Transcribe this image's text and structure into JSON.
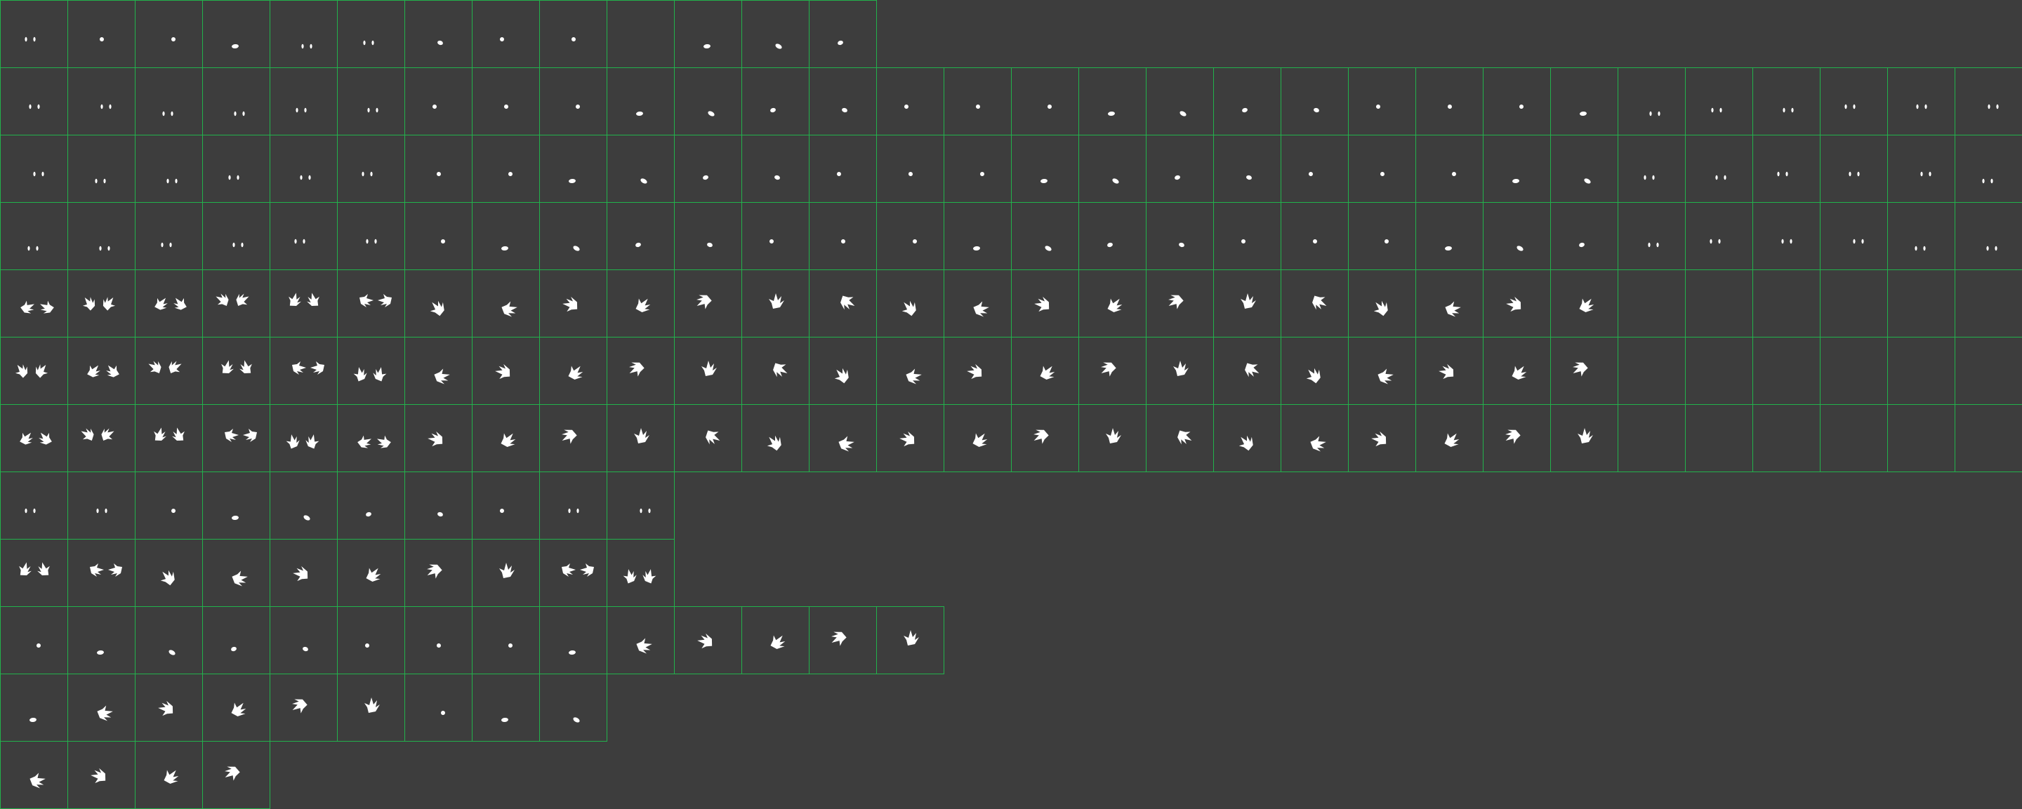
{
  "sprite_sheet": {
    "background_color": "#3d3d3d",
    "grid_color": "#22b24c",
    "sprite_color": "#ffffff",
    "rows": [
      {
        "name": "eyes-row-1",
        "frames": [
          "eyes",
          "blob",
          "blob",
          "blob",
          "eyes",
          "eyes",
          "blob",
          "blob",
          "blob",
          "empty",
          "blob",
          "blob",
          "blob"
        ]
      },
      {
        "name": "eyes-row-2",
        "frames": [
          "eyes",
          "eyes",
          "eyes",
          "eyes",
          "eyes",
          "eyes",
          "blob",
          "blob",
          "blob",
          "blob",
          "blob",
          "blob",
          "blob",
          "blob",
          "blob",
          "blob",
          "blob",
          "blob",
          "blob",
          "blob",
          "blob",
          "blob",
          "blob",
          "blob",
          "eyes",
          "eyes",
          "eyes",
          "eyes",
          "eyes",
          "eyes"
        ]
      },
      {
        "name": "eyes-row-3",
        "frames": [
          "eyes",
          "eyes",
          "eyes",
          "eyes",
          "eyes",
          "eyes",
          "blob",
          "blob",
          "blob",
          "blob",
          "blob",
          "blob",
          "blob",
          "blob",
          "blob",
          "blob",
          "blob",
          "blob",
          "blob",
          "blob",
          "blob",
          "blob",
          "blob",
          "blob",
          "eyes",
          "eyes",
          "eyes",
          "eyes",
          "eyes",
          "eyes"
        ]
      },
      {
        "name": "eyes-row-4",
        "frames": [
          "eyes",
          "eyes",
          "eyes",
          "eyes",
          "eyes",
          "eyes",
          "blob",
          "blob",
          "blob",
          "blob",
          "blob",
          "blob",
          "blob",
          "blob",
          "blob",
          "blob",
          "blob",
          "blob",
          "blob",
          "blob",
          "blob",
          "blob",
          "blob",
          "blob",
          "eyes",
          "eyes",
          "eyes",
          "eyes",
          "eyes",
          "eyes"
        ]
      },
      {
        "name": "claws-row-1",
        "frames": [
          "claw-pair",
          "claw-pair",
          "claw-pair",
          "claw-pair",
          "claw-pair",
          "claw-pair",
          "claw",
          "claw",
          "claw",
          "claw",
          "claw",
          "claw",
          "claw",
          "claw",
          "claw",
          "claw",
          "claw",
          "claw",
          "claw",
          "claw",
          "claw",
          "claw",
          "claw",
          "claw",
          "empty",
          "empty",
          "empty",
          "empty",
          "empty",
          "empty"
        ]
      },
      {
        "name": "claws-row-2",
        "frames": [
          "claw-pair",
          "claw-pair",
          "claw-pair",
          "claw-pair",
          "claw-pair",
          "claw-pair",
          "claw",
          "claw",
          "claw",
          "claw",
          "claw",
          "claw",
          "claw",
          "claw",
          "claw",
          "claw",
          "claw",
          "claw",
          "claw",
          "claw",
          "claw",
          "claw",
          "claw",
          "claw",
          "empty",
          "empty",
          "empty",
          "empty",
          "empty",
          "empty"
        ]
      },
      {
        "name": "claws-row-3",
        "frames": [
          "claw-pair",
          "claw-pair",
          "claw-pair",
          "claw-pair",
          "claw-pair",
          "claw-pair",
          "claw",
          "claw",
          "claw",
          "claw",
          "claw",
          "claw",
          "claw",
          "claw",
          "claw",
          "claw",
          "claw",
          "claw",
          "claw",
          "claw",
          "claw",
          "claw",
          "claw",
          "claw",
          "empty",
          "empty",
          "empty",
          "empty",
          "empty",
          "empty"
        ]
      },
      {
        "name": "eyes-row-5",
        "frames": [
          "eyes",
          "eyes",
          "blob",
          "blob",
          "blob",
          "blob",
          "blob",
          "blob",
          "eyes",
          "eyes"
        ]
      },
      {
        "name": "claws-row-4",
        "frames": [
          "claw-pair",
          "claw-pair",
          "claw",
          "claw",
          "claw",
          "claw",
          "claw",
          "claw",
          "claw-pair",
          "claw-pair"
        ]
      },
      {
        "name": "mixed-row-1",
        "frames": [
          "blob",
          "blob",
          "blob",
          "blob",
          "blob",
          "blob",
          "blob",
          "blob",
          "blob",
          "claw",
          "claw",
          "claw",
          "claw",
          "claw"
        ]
      },
      {
        "name": "mixed-row-2",
        "frames": [
          "blob",
          "claw",
          "claw",
          "claw",
          "claw",
          "claw",
          "blob",
          "blob",
          "blob"
        ]
      },
      {
        "name": "claws-row-5",
        "frames": [
          "claw",
          "claw",
          "claw",
          "claw"
        ]
      }
    ]
  }
}
